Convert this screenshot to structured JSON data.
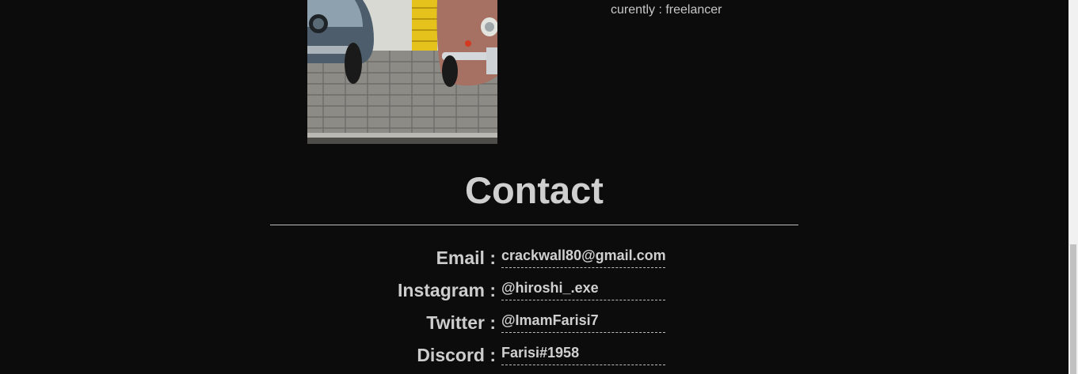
{
  "profile": {
    "current_job": "curently : freelancer"
  },
  "contact": {
    "title": "Contact",
    "items": [
      {
        "label": "Email :",
        "value": "crackwall80@gmail.com"
      },
      {
        "label": "Instagram :",
        "value": "@hiroshi_.exe"
      },
      {
        "label": "Twitter :",
        "value": "@ImamFarisi7"
      },
      {
        "label": "Discord :",
        "value": "Farisi#1958"
      }
    ]
  },
  "colors": {
    "background": "#0c0c0c",
    "text": "#cfcfcf",
    "accent_yellow": "#e6c21c"
  }
}
